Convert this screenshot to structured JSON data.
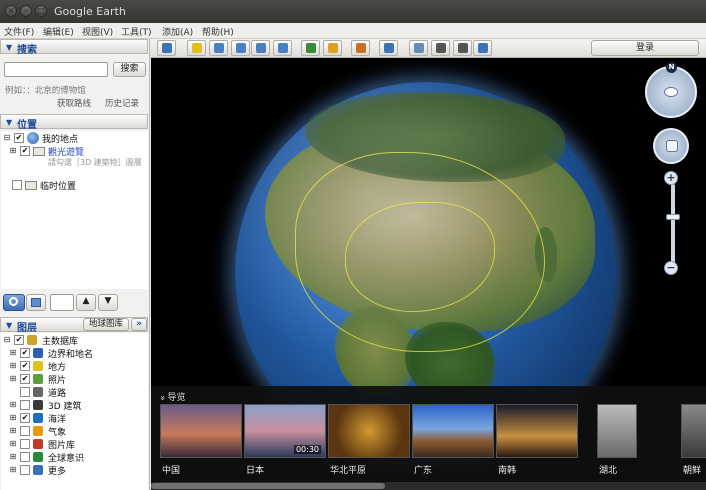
{
  "window": {
    "title": "Google Earth",
    "close_glyph": "×",
    "minimize_glyph": "–",
    "maximize_glyph": "□"
  },
  "menu": {
    "items": [
      "文件(F)",
      "编辑(E)",
      "视图(V)",
      "工具(T)",
      "添加(A)",
      "帮助(H)"
    ]
  },
  "search": {
    "header": "搜索",
    "input_value": "",
    "button_label": "搜索",
    "hint": "例如：：北京的博物馆",
    "get_directions": "获取路线",
    "history": "历史记录"
  },
  "places": {
    "header": "位置",
    "items": [
      {
        "label": "我的地点",
        "checked": true,
        "expander": "⊟"
      },
      {
        "label": "觀光遊覽",
        "checked": true,
        "expander": "⊞",
        "highlight": true
      },
      {
        "label": "临时位置",
        "checked": false,
        "expander": ""
      }
    ],
    "sub_note": "請勾選［3D 建築物］圖層"
  },
  "panel_controls": {
    "up_arrow": "▲",
    "down_arrow": "▼"
  },
  "layers": {
    "header": "图层",
    "gallery_button": "地球图库",
    "gallery_more": "»",
    "items": [
      {
        "label": "主数据库",
        "checked": true,
        "expander": "⊟",
        "icon_color": "#d2a52a"
      },
      {
        "label": "边界和地名",
        "checked": true,
        "expander": "⊞",
        "icon_color": "#2b5fb0"
      },
      {
        "label": "地方",
        "checked": true,
        "expander": "⊞",
        "icon_color": "#e0c020"
      },
      {
        "label": "照片",
        "checked": true,
        "expander": "⊞",
        "icon_color": "#5a9e3a"
      },
      {
        "label": "道路",
        "checked": false,
        "expander": "",
        "icon_color": "#666666"
      },
      {
        "label": "3D 建筑",
        "checked": false,
        "expander": "⊞",
        "icon_color": "#3a3a3a"
      },
      {
        "label": "海洋",
        "checked": true,
        "expander": "⊞",
        "icon_color": "#1f6fc0"
      },
      {
        "label": "气象",
        "checked": false,
        "expander": "⊞",
        "icon_color": "#e89a10"
      },
      {
        "label": "图片库",
        "checked": false,
        "expander": "⊞",
        "icon_color": "#c23a2a"
      },
      {
        "label": "全球意识",
        "checked": false,
        "expander": "⊞",
        "icon_color": "#2a8a3a"
      },
      {
        "label": "更多",
        "checked": false,
        "expander": "⊞",
        "icon_color": "#3b70b8"
      }
    ]
  },
  "toolbar": {
    "signin_label": "登录",
    "buttons": [
      {
        "name": "sidebar-toggle-icon",
        "color": "#3d73b8"
      },
      {
        "name": "placemark-icon",
        "color": "#e2c020"
      },
      {
        "name": "polygon-icon",
        "color": "#4b7fc4"
      },
      {
        "name": "path-icon",
        "color": "#4b7fc4"
      },
      {
        "name": "image-overlay-icon",
        "color": "#4b7fc4"
      },
      {
        "name": "record-tour-icon",
        "color": "#4b7fc4"
      },
      {
        "name": "historical-imagery-icon",
        "color": "#3a8a3a"
      },
      {
        "name": "sunlight-icon",
        "color": "#e0a020"
      },
      {
        "name": "switch-to-sky-icon",
        "color": "#c87020"
      },
      {
        "name": "ruler-icon",
        "color": "#3d73b8"
      },
      {
        "name": "email-icon",
        "color": "#6a8ab8"
      },
      {
        "name": "print-icon",
        "color": "#555555"
      },
      {
        "name": "save-image-icon",
        "color": "#555555"
      },
      {
        "name": "view-in-maps-icon",
        "color": "#3d73b8"
      }
    ]
  },
  "navigation": {
    "north_label": "N",
    "zoom_in": "+",
    "zoom_out": "−",
    "zoom_level": 0.35
  },
  "tour": {
    "title": "导览",
    "collapse_glyph": "»",
    "items": [
      {
        "label": "中国",
        "time": ""
      },
      {
        "label": "日本",
        "time": "00:30"
      },
      {
        "label": "华北平原",
        "time": ""
      },
      {
        "label": "广东",
        "time": ""
      },
      {
        "label": "南韩",
        "time": ""
      },
      {
        "label": "湖北",
        "time": ""
      },
      {
        "label": "朝鲜",
        "time": ""
      }
    ],
    "scroll_position": 0.0
  },
  "colors": {
    "accent_blue": "#1d4a95",
    "globe_ocean": "#2a66b3",
    "border_yellow": "#e6e23a"
  }
}
